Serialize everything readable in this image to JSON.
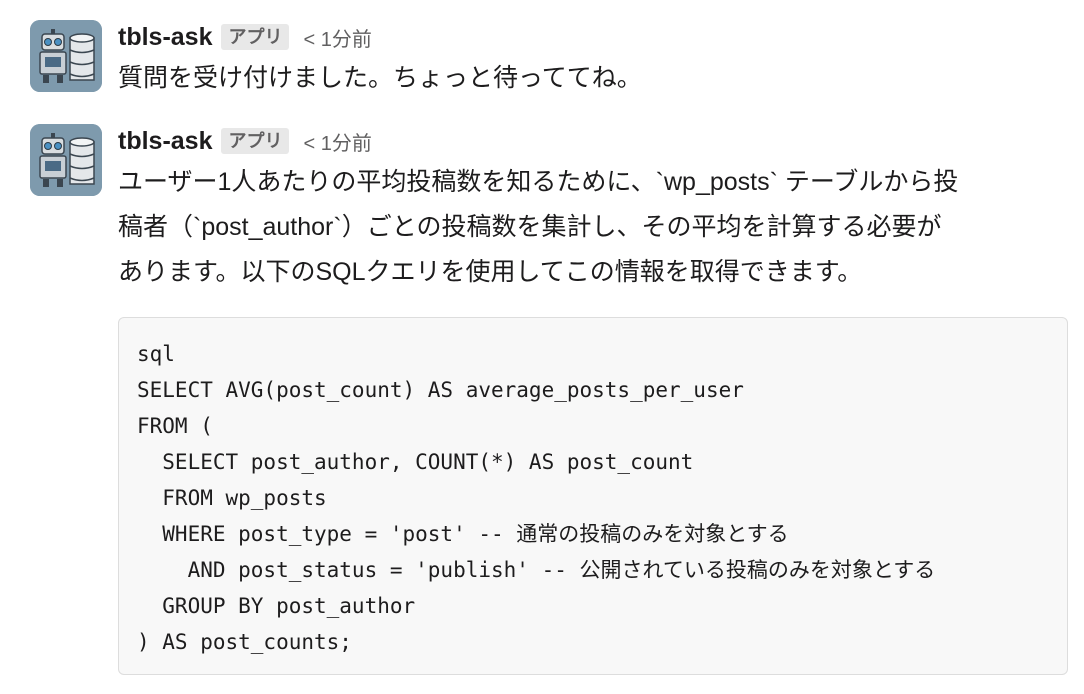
{
  "messages": [
    {
      "sender": "tbls-ask",
      "badge": "アプリ",
      "timestamp": "< 1分前",
      "text": "質問を受け付けました。ちょっと待っててね。"
    },
    {
      "sender": "tbls-ask",
      "badge": "アプリ",
      "timestamp": "< 1分前",
      "paragraph_lines": [
        "ユーザー1人あたりの平均投稿数を知るために、`wp_posts` テーブルから投",
        "稿者（`post_author`）ごとの投稿数を集計し、その平均を計算する必要が",
        "あります。以下のSQLクエリを使用してこの情報を取得できます。"
      ],
      "code_lines": [
        "sql",
        "SELECT AVG(post_count) AS average_posts_per_user",
        "FROM (",
        "  SELECT post_author, COUNT(*) AS post_count",
        "  FROM wp_posts",
        "  WHERE post_type = 'post' -- 通常の投稿のみを対象とする",
        "    AND post_status = 'publish' -- 公開されている投稿のみを対象とする",
        "  GROUP BY post_author",
        ") AS post_counts;"
      ]
    }
  ],
  "avatar": {
    "icon": "robot-database-icon",
    "background_color": "#7e9aad"
  }
}
